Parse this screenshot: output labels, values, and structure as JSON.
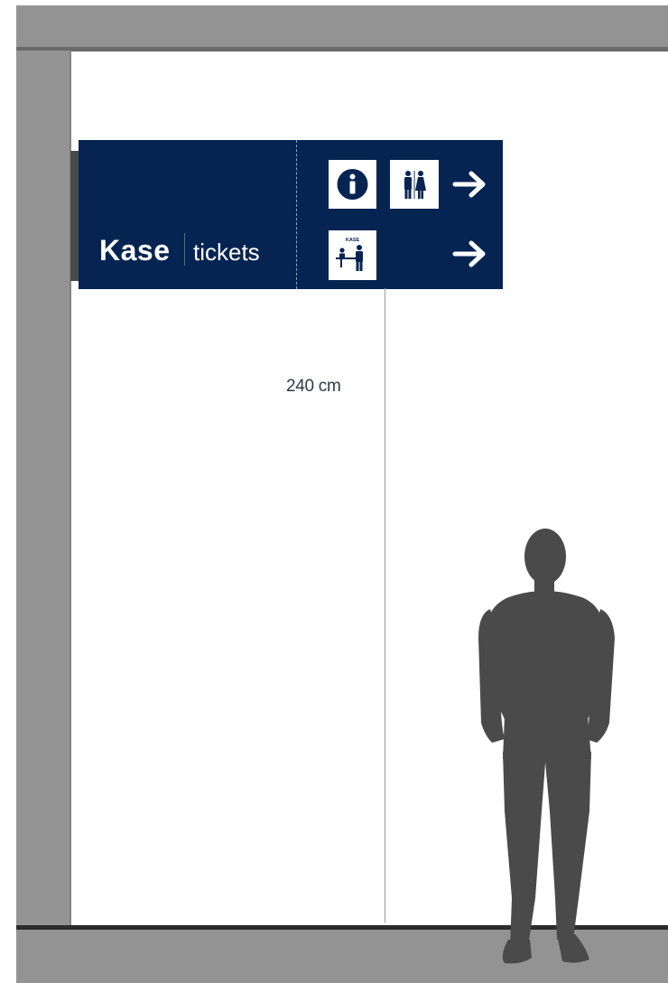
{
  "sign": {
    "primary_label": "Kase",
    "secondary_label": "tickets",
    "background_color": "#052452",
    "rows": [
      {
        "icons": [
          "info-icon",
          "restroom-icon"
        ],
        "direction": "right-arrow-icon"
      },
      {
        "icons": [
          "ticket-desk-icon"
        ],
        "direction": "right-arrow-icon",
        "icon_caption": "KASE"
      }
    ]
  },
  "dimension": {
    "label": "240 cm"
  },
  "scene": {
    "wall_color": "#949494",
    "floor_color": "#939393",
    "figure_color": "#4a4a4a"
  }
}
